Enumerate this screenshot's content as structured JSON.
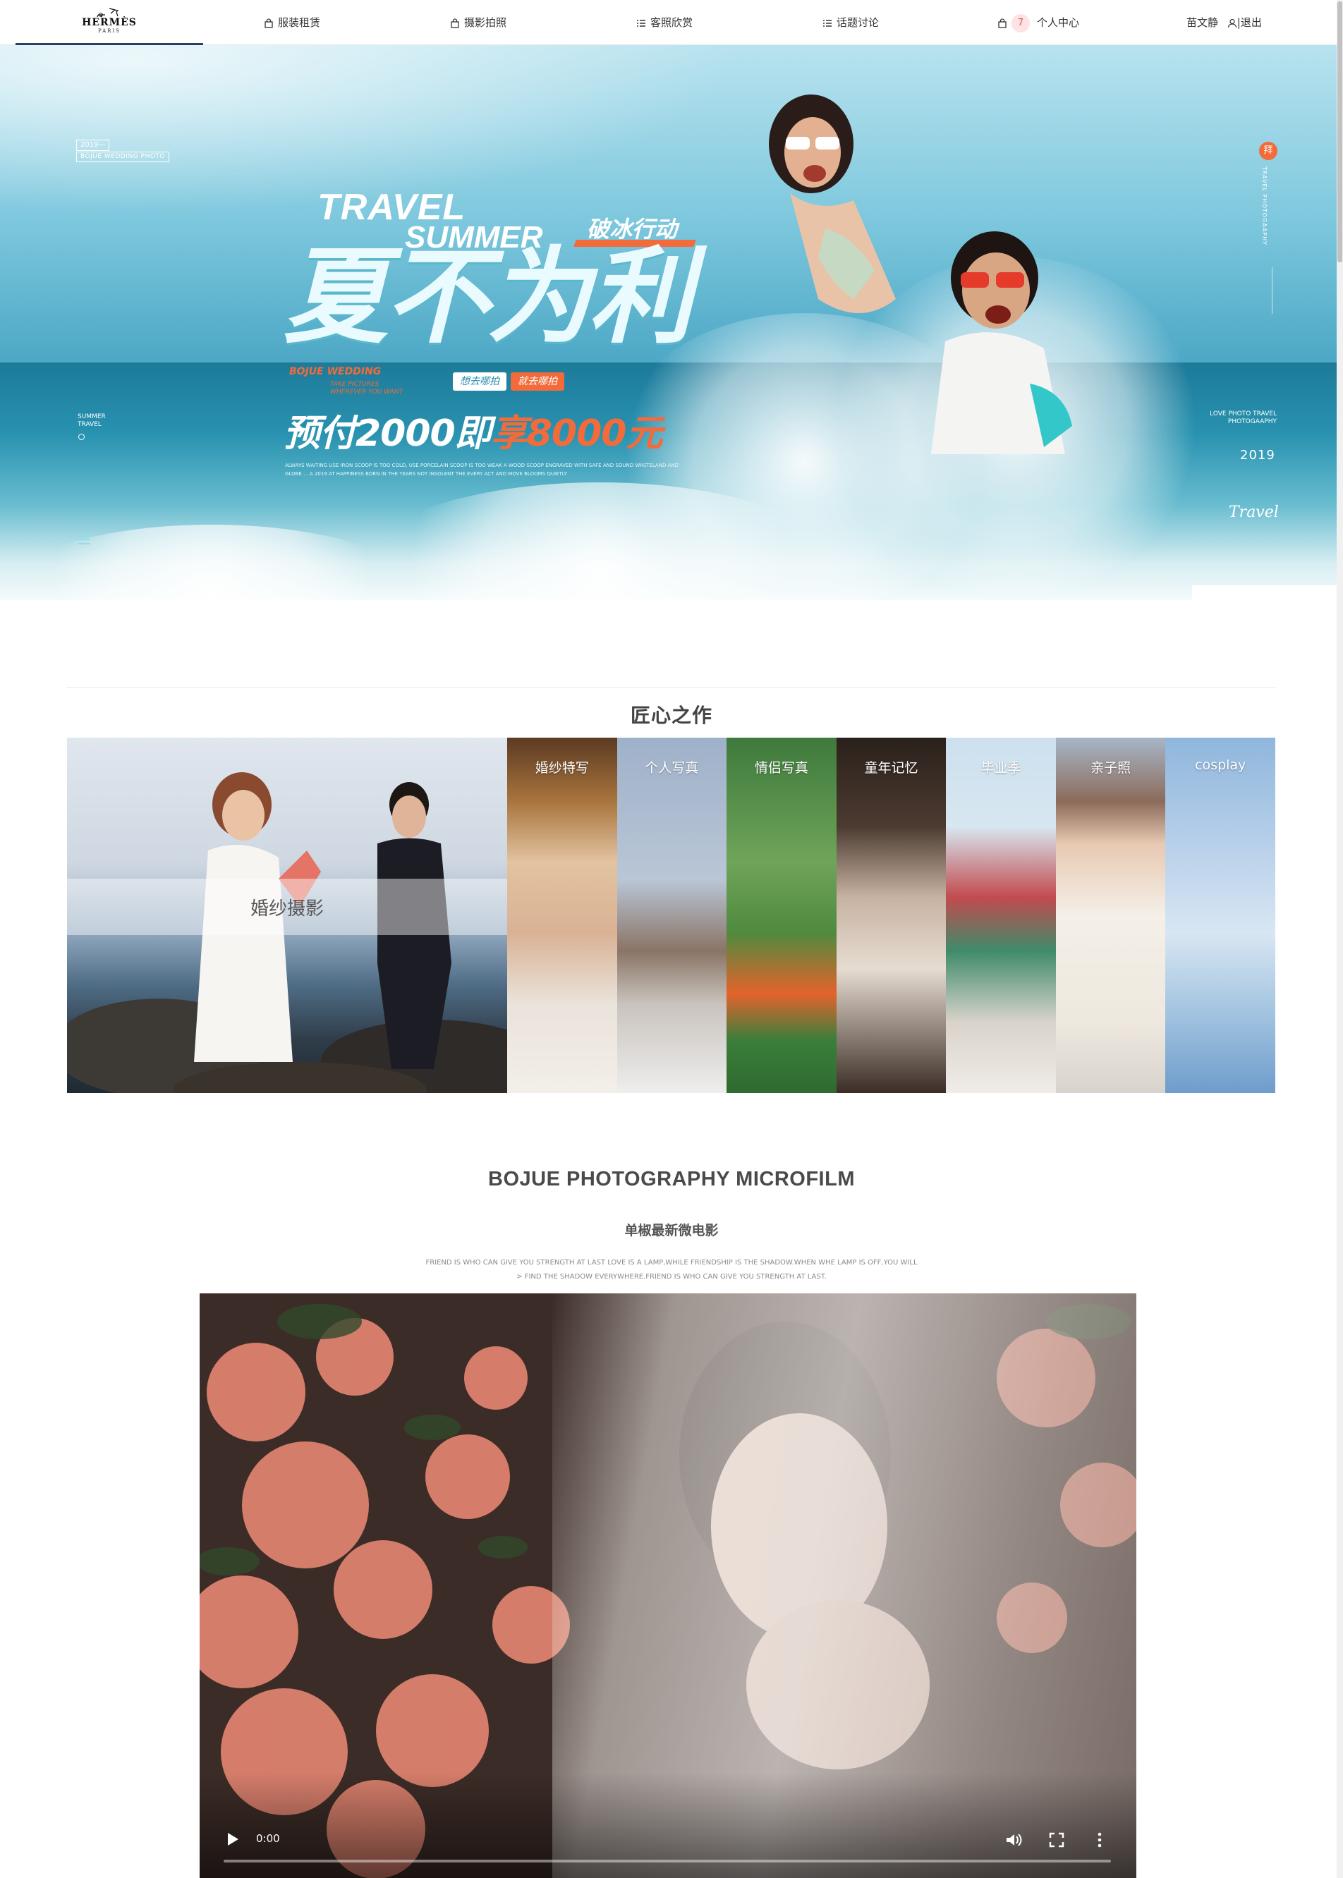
{
  "header": {
    "logo": {
      "brand": "HERMÈS",
      "sub": "PARIS"
    },
    "nav": [
      {
        "label": "服装租赁",
        "icon": "bag-icon"
      },
      {
        "label": "摄影拍照",
        "icon": "bag-icon"
      },
      {
        "label": "客照欣赏",
        "icon": "list-icon"
      },
      {
        "label": "话题讨论",
        "icon": "list-icon"
      }
    ],
    "personal": {
      "label": "个人中心",
      "icon": "bag-icon",
      "badge": "7"
    },
    "user": {
      "name": "苗文静",
      "logout": "|退出",
      "icon": "user-icon"
    }
  },
  "hero": {
    "tag_year": "2019—",
    "tag_wedding": "BOJUE WEDDING PHOTO",
    "left_text": "SUMMER\nTRAVEL",
    "travel": "TRAVEL",
    "summer": "SUMMER",
    "action": "破冰行动",
    "main": "夏不为利",
    "bojue": "BOJUE WEDDING",
    "bojue_sub": "TAKE PICTURES\nWHEREVER YOU WANT",
    "pill_a": "想去哪拍",
    "pill_b": "就去哪拍",
    "promo_a": "预付2000即",
    "promo_b": "享8000元",
    "fine_print": "ALWAYS WAITING USE IRON SCOOP IS TOO COLD, USE PORCELAIN SCOOP IS TOO WEAK A WOOD SCOOP ENGRAVED WITH SAFE AND SOUND WASTELAND AND GLOBE ... A 2019 AT HAPPINESS BORN IN THE YEARS NOT INSOLENT THE EVERY ACT AND MOVE BLOOMS QUIETLY",
    "right_badge": "拜",
    "right_vertical": "TRAVEL PHOTOGAAPHY",
    "love_text": "LOVE PHOTO TRAVEL\nPHOTOGAAPHY",
    "year_right": "2019",
    "travel_script": "Travel",
    "slides": 2,
    "active_slide": 2
  },
  "section_works": {
    "title": "匠心之作",
    "items": [
      {
        "label": "婚纱摄影"
      },
      {
        "label": "婚纱特写"
      },
      {
        "label": "个人写真"
      },
      {
        "label": "情侣写真"
      },
      {
        "label": "童年记忆"
      },
      {
        "label": "毕业季"
      },
      {
        "label": "亲子照"
      },
      {
        "label": "cosplay"
      }
    ]
  },
  "section_film": {
    "title": "BOJUE PHOTOGRAPHY MICROFILM",
    "subtitle": "单椒最新微电影",
    "desc_line1": "FRIEND IS WHO CAN GIVE YOU STRENGTH AT LAST LOVE IS A LAMP,WHILE FRIENDSHIP IS THE SHADOW.WHEN WHE LAMP IS OFF,YOU WILL",
    "desc_line2": "> FIND THE SHADOW EVERYWHERE.FRIEND IS WHO CAN GIVE YOU STRENGTH AT LAST.",
    "video_time": "0:00",
    "video_progress": 0
  },
  "colors": {
    "accent": "#f36b3a",
    "nav_underline": "#2a3f66",
    "badge_bg": "#fde3e3",
    "badge_text": "#e55353",
    "dot_active": "#2a6fd6"
  }
}
